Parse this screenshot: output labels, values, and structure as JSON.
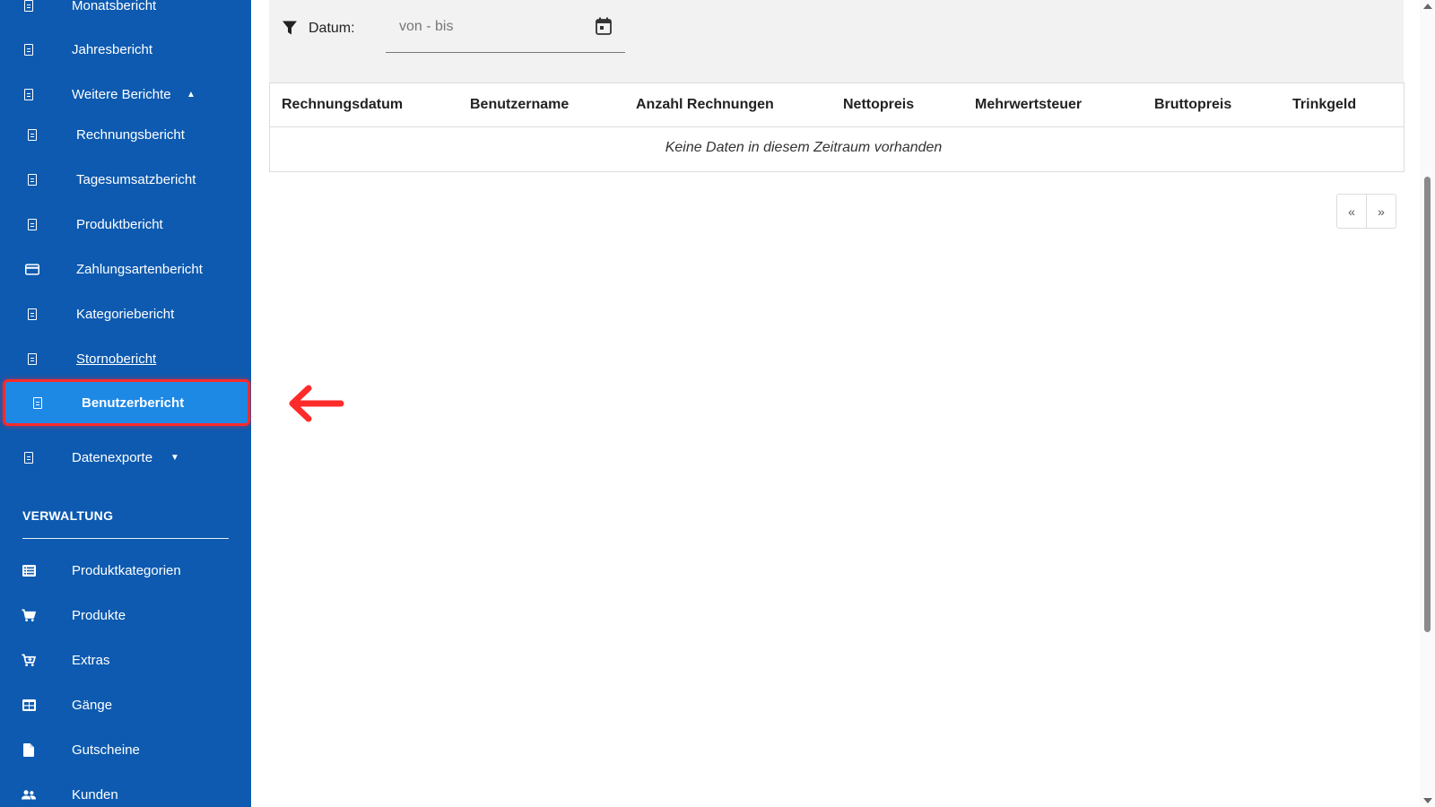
{
  "sidebar": {
    "items": [
      {
        "label": "Monatsbericht",
        "icon": "document-icon"
      },
      {
        "label": "Jahresbericht",
        "icon": "document-icon"
      },
      {
        "label": "Weitere Berichte",
        "icon": "document-icon"
      },
      {
        "label": "Rechnungsbericht",
        "icon": "document-outline-icon"
      },
      {
        "label": "Tagesumsatzbericht",
        "icon": "document-icon"
      },
      {
        "label": "Produktbericht",
        "icon": "document-icon"
      },
      {
        "label": "Zahlungsartenbericht",
        "icon": "credit-card-icon"
      },
      {
        "label": "Kategoriebericht",
        "icon": "document-icon"
      },
      {
        "label": "Stornobericht",
        "icon": "document-icon"
      },
      {
        "label": "Benutzerbericht",
        "icon": "document-icon"
      },
      {
        "label": "Datenexporte",
        "icon": "document-icon"
      }
    ],
    "section_title": "VERWALTUNG",
    "admin_items": [
      {
        "label": "Produktkategorien",
        "icon": "list-icon"
      },
      {
        "label": "Produkte",
        "icon": "cart-icon"
      },
      {
        "label": "Extras",
        "icon": "cart-plus-icon"
      },
      {
        "label": "Gänge",
        "icon": "table-icon"
      },
      {
        "label": "Gutscheine",
        "icon": "file-icon"
      },
      {
        "label": "Kunden",
        "icon": "users-icon"
      }
    ],
    "colors": {
      "background": "#0d5ab0",
      "active": "#1e88e5",
      "highlight": "#ff2a2a"
    }
  },
  "filter": {
    "label": "Datum:",
    "date_placeholder": "von - bis"
  },
  "table": {
    "columns": [
      "Rechnungsdatum",
      "Benutzername",
      "Anzahl Rechnungen",
      "Nettopreis",
      "Mehrwertsteuer",
      "Bruttopreis",
      "Trinkgeld"
    ],
    "empty_message": "Keine Daten in diesem Zeitraum vorhanden"
  },
  "pagination": {
    "prev": "«",
    "next": "»"
  }
}
